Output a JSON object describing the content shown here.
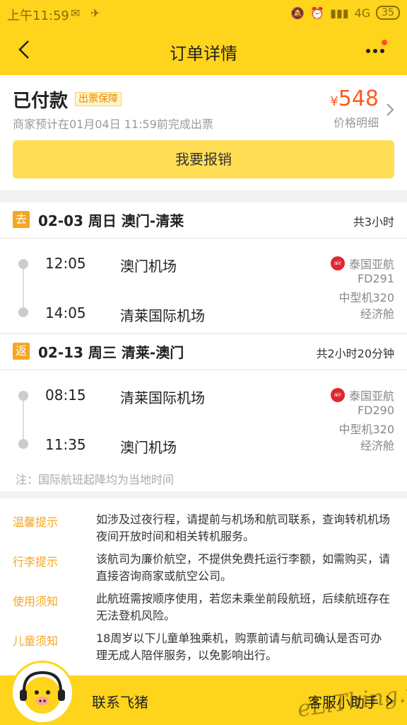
{
  "status_bar": {
    "time": "上午11:59",
    "network": "4G",
    "battery": "35"
  },
  "header": {
    "title": "订单详情"
  },
  "order": {
    "status": "已付款",
    "guarantee_tag": "出票保障",
    "eta": "商家预计在01月04日 11:59前完成出票",
    "currency": "¥",
    "price": "548",
    "price_detail": "价格明细",
    "refund_button": "我要报销"
  },
  "segments": [
    {
      "tag": "去",
      "date_route": "02-03 周日 澳门-清莱",
      "duration": "共3小时",
      "dep_time": "12:05",
      "dep_airport": "澳门机场",
      "arr_time": "14:05",
      "arr_airport": "清莱国际机场",
      "airline": "泰国亚航",
      "flight_no": "FD291",
      "aircraft": "中型机320",
      "cabin": "经济舱"
    },
    {
      "tag": "返",
      "date_route": "02-13 周三 清莱-澳门",
      "duration": "共2小时20分钟",
      "dep_time": "08:15",
      "dep_airport": "清莱国际机场",
      "arr_time": "11:35",
      "arr_airport": "澳门机场",
      "airline": "泰国亚航",
      "flight_no": "FD290",
      "aircraft": "中型机320",
      "cabin": "经济舱"
    }
  ],
  "note": "注：国际航班起降均为当地时间",
  "tips": [
    {
      "label": "温馨提示",
      "text": "如涉及过夜行程，请提前与机场和航司联系，查询转机机场夜间开放时间和相关转机服务。"
    },
    {
      "label": "行李提示",
      "text": "该航司为廉价航空，不提供免费托运行李额，如需购买，请直接咨询商家或航空公司。"
    },
    {
      "label": "使用须知",
      "text": "此航班需按顺序使用，若您未乘坐前段航班，后续航班存在无法登机风险。"
    },
    {
      "label": "儿童须知",
      "text": "18周岁以下儿童单独乘机，购票前请与航司确认是否可办理无成人陪伴服务，以免影响出行。"
    }
  ],
  "bottom": {
    "contact": "联系飞猪",
    "assistant": "客服小助手"
  },
  "colors": {
    "brand_yellow": "#ffd41c",
    "accent_orange": "#f5a623",
    "price_orange": "#ff5a1f"
  }
}
